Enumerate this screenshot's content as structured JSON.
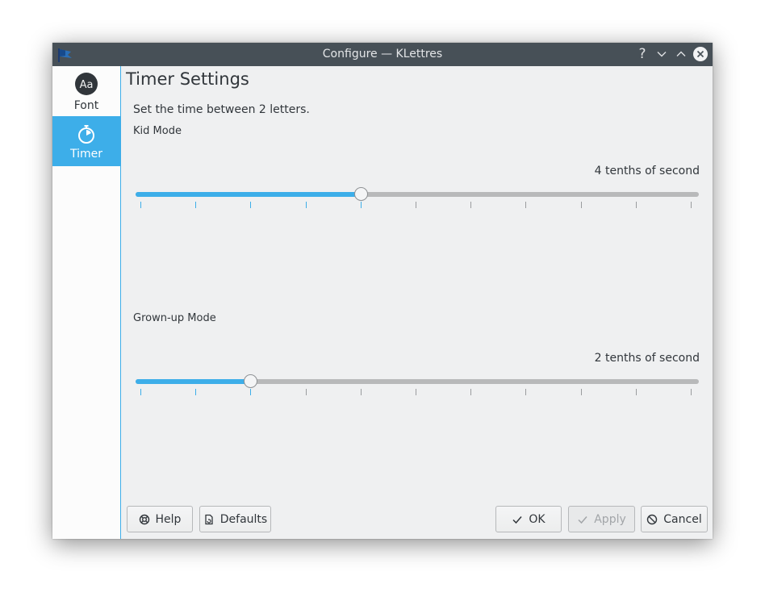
{
  "window": {
    "title": "Configure — KLettres",
    "controls": {
      "help_glyph": "?"
    }
  },
  "sidebar": {
    "items": [
      {
        "label": "Font",
        "icon": "font-icon",
        "icon_text": "Aa",
        "selected": false
      },
      {
        "label": "Timer",
        "icon": "timer-icon",
        "selected": true
      }
    ]
  },
  "page": {
    "title": "Timer Settings",
    "description": "Set the time between 2 letters.",
    "kid": {
      "label": "Kid Mode",
      "value": 4,
      "min": 0,
      "max": 10,
      "value_text": "4 tenths of second"
    },
    "grownup": {
      "label": "Grown-up Mode",
      "value": 2,
      "min": 0,
      "max": 10,
      "value_text": "2 tenths of second"
    }
  },
  "buttons": {
    "help": "Help",
    "defaults": "Defaults",
    "ok": "OK",
    "apply": "Apply",
    "cancel": "Cancel"
  },
  "colors": {
    "accent": "#3daee9",
    "titlebar": "#475057",
    "background": "#eff0f1",
    "text": "#31363b"
  }
}
